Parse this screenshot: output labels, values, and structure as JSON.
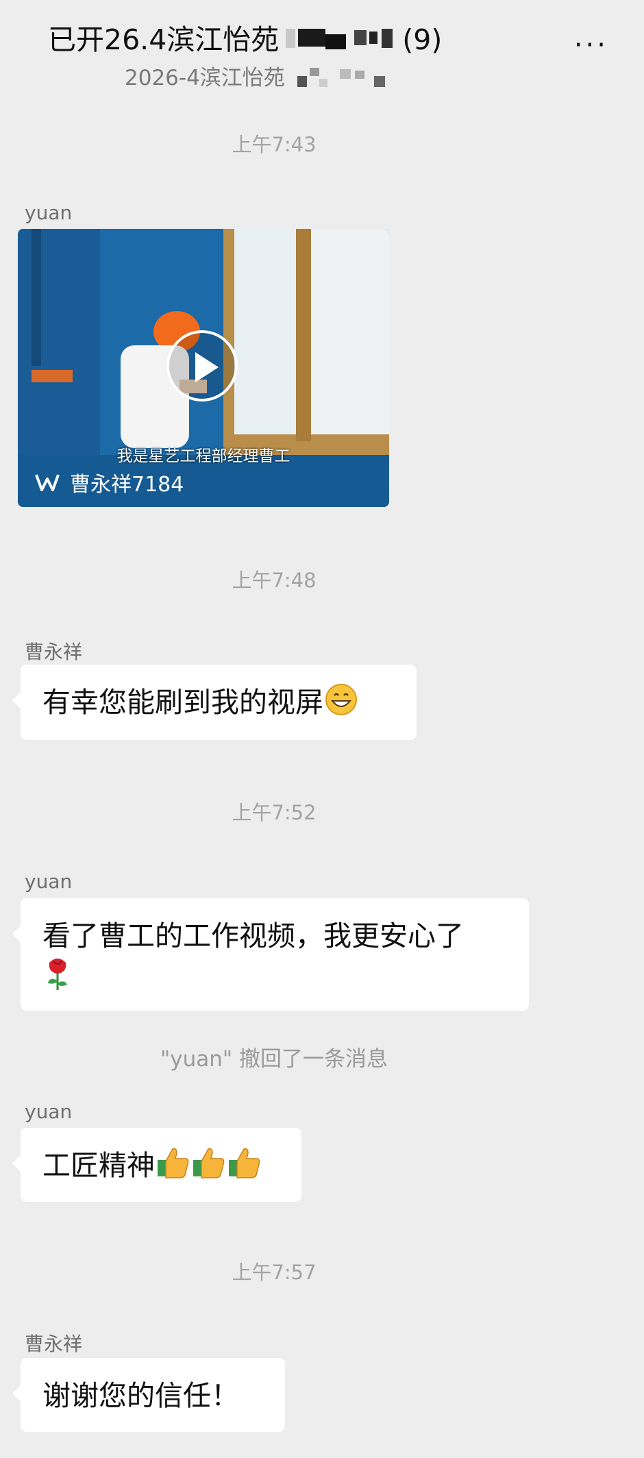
{
  "header": {
    "title_prefix": "已开26.4滨江怡苑",
    "title_suffix": "(9)",
    "subtitle": "2026-4滨江怡苑",
    "more": "···"
  },
  "messages": {
    "t1": "上午7:43",
    "video": {
      "sender": "yuan",
      "caption": "我是星艺工程部经理曹工",
      "channel": "曹永祥7184",
      "play_icon": "play-icon",
      "channel_icon": "channels-icon"
    },
    "t2": "上午7:48",
    "m1": {
      "sender": "曹永祥",
      "text": "有幸您能刷到我的视屏",
      "emoji": "grinning-face"
    },
    "t3": "上午7:52",
    "m2": {
      "sender": "yuan",
      "text": "看了曹工的工作视频，我更安心了",
      "emoji": "rose"
    },
    "recall": "\"yuan\" 撤回了一条消息",
    "m3": {
      "sender": "yuan",
      "text": "工匠精神",
      "emoji": "thumbs-up x3"
    },
    "t4": "上午7:57",
    "m4": {
      "sender": "曹永祥",
      "text": "谢谢您的信任！"
    }
  },
  "colors": {
    "background": "#ededed",
    "bubble": "#ffffff",
    "timestamp": "#a3a3a3",
    "nickname": "#6e6e6e"
  }
}
